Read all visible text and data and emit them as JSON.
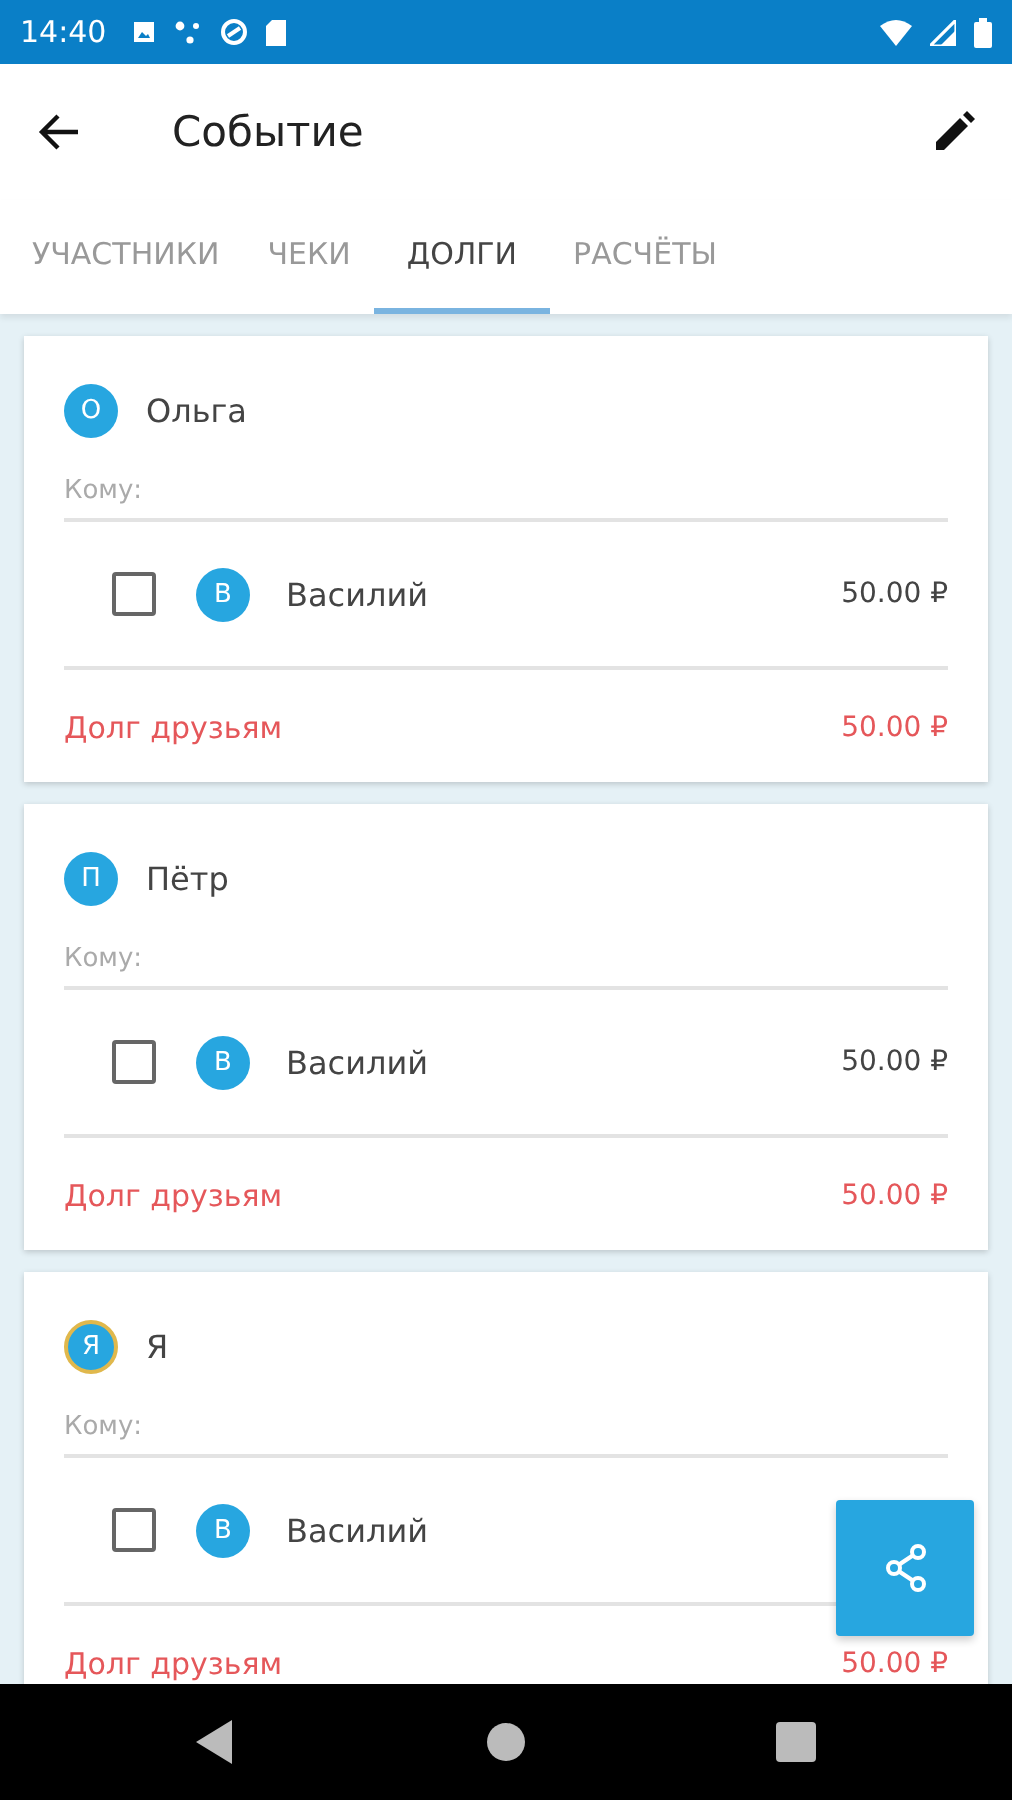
{
  "status_bar": {
    "time": "14:40"
  },
  "app_bar": {
    "title": "Событие"
  },
  "tabs": [
    {
      "label": "УЧАСТНИКИ",
      "selected": false
    },
    {
      "label": "ЧЕКИ",
      "selected": false
    },
    {
      "label": "ДОЛГИ",
      "selected": true
    },
    {
      "label": "РАСЧЁТЫ",
      "selected": false
    }
  ],
  "debts": [
    {
      "debtor": {
        "initial": "О",
        "name": "Ольга",
        "highlighted": false
      },
      "to_label": "Кому:",
      "creditors": [
        {
          "initial": "В",
          "name": "Василий",
          "amount": "50.00 ₽",
          "checked": false
        }
      ],
      "total_label": "Долг друзьям",
      "total": "50.00 ₽"
    },
    {
      "debtor": {
        "initial": "П",
        "name": "Пётр",
        "highlighted": false
      },
      "to_label": "Кому:",
      "creditors": [
        {
          "initial": "В",
          "name": "Василий",
          "amount": "50.00 ₽",
          "checked": false
        }
      ],
      "total_label": "Долг друзьям",
      "total": "50.00 ₽"
    },
    {
      "debtor": {
        "initial": "Я",
        "name": "Я",
        "highlighted": true
      },
      "to_label": "Кому:",
      "creditors": [
        {
          "initial": "В",
          "name": "Василий",
          "checked": false
        }
      ],
      "total_label": "Долг друзьям",
      "total": "50.00 ₽"
    }
  ]
}
